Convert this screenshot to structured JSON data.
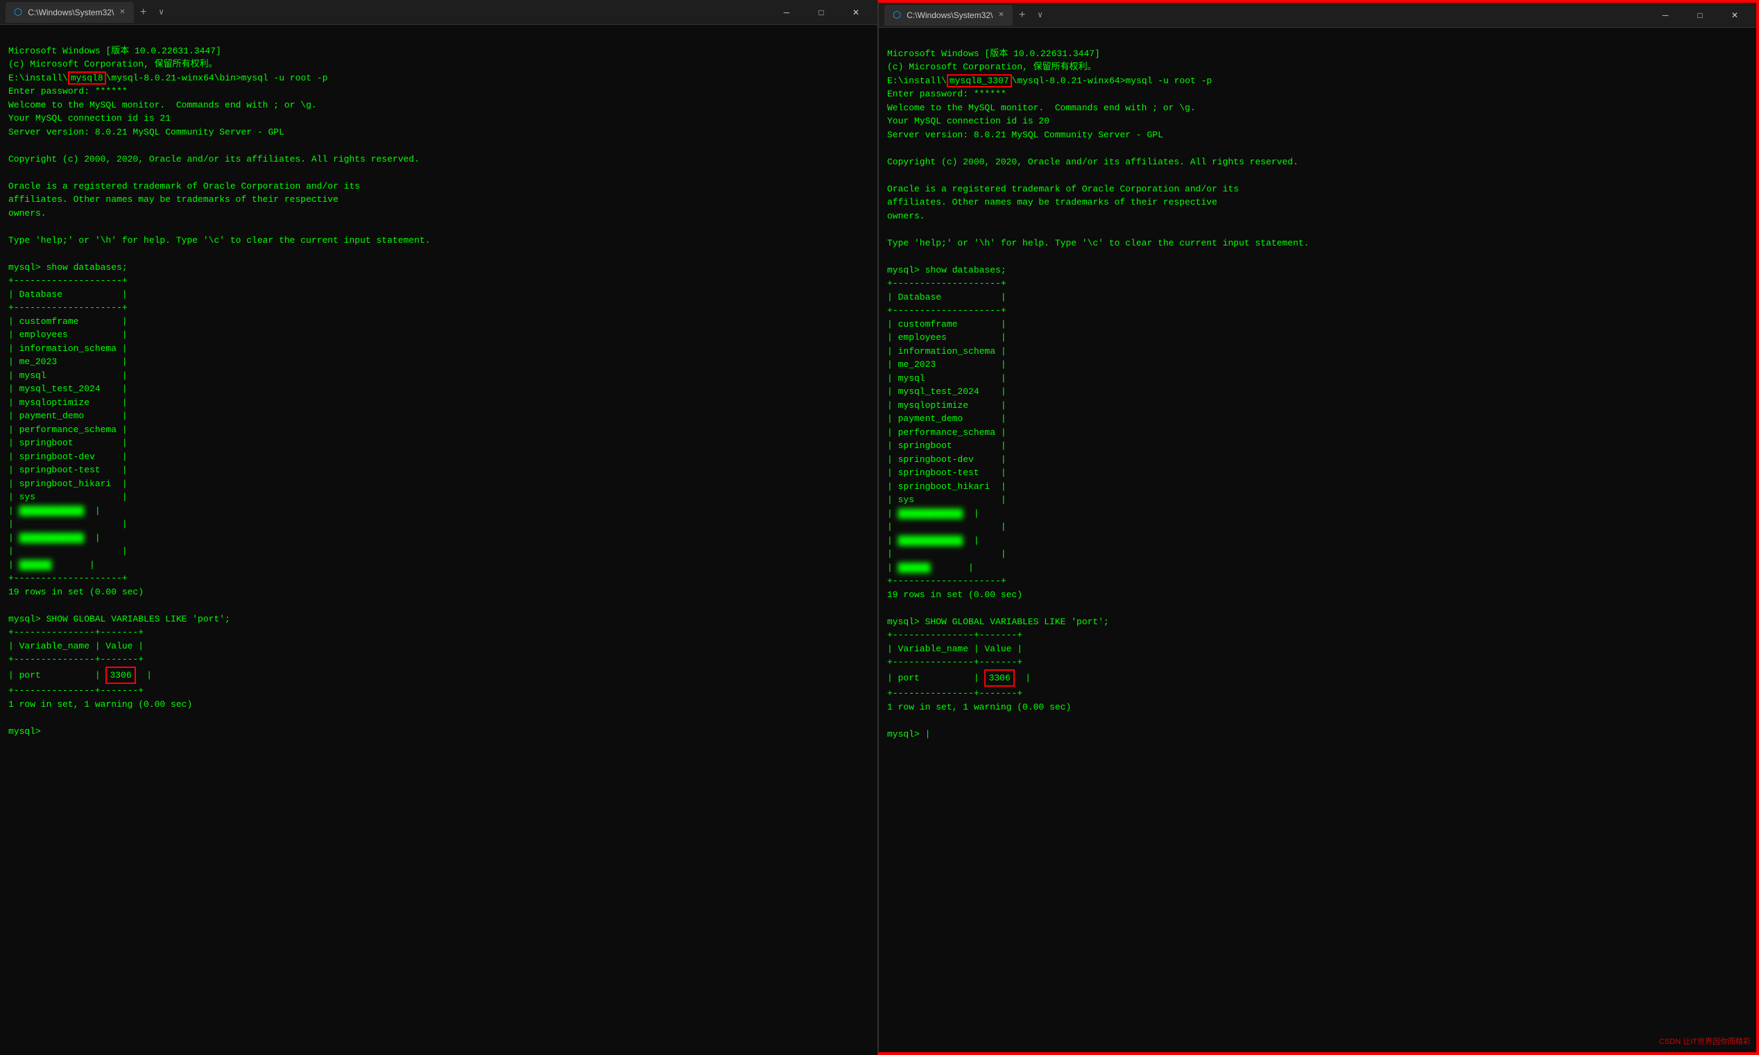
{
  "windows": [
    {
      "id": "left",
      "title": "C:\\Windows\\System32\\",
      "tab_label": "C:\\Windows\\System32\\",
      "content": {
        "line1": "Microsoft Windows [版本 10.0.22631.3447]",
        "line2": "(c) Microsoft Corporation, 保留所有权利。",
        "line3_pre": "E:\\install\\",
        "line3_hl": "mysql8",
        "line3_post": "\\mysql-8.0.21-winx64\\bin>mysql -u root -p",
        "line4": "Enter password: ******",
        "line5": "Welcome to the MySQL monitor.  Commands end with ; or \\g.",
        "line6": "Your MySQL connection id is 21",
        "line7": "Server version: 8.0.21 MySQL Community Server - GPL",
        "line8": "",
        "line9": "Copyright (c) 2000, 2020, Oracle and/or its affiliates. All rights reserved.",
        "line10": "",
        "line11": "Oracle is a registered trademark of Oracle Corporation and/or its",
        "line12": "affiliates. Other names may be trademarks of their respective",
        "line13": "owners.",
        "line14": "",
        "line15": "Type 'help;' or '\\h' for help. Type '\\c' to clear the current input statement.",
        "line16": "",
        "line17": "mysql> show databases;",
        "line18": "+--------------------+",
        "line19": "| Database           |",
        "line20": "+--------------------+",
        "db_list": [
          "customframe",
          "employees",
          "information_schema",
          "me_2023",
          "mysql",
          "mysql_test_2024",
          "mysqloptimize",
          "payment_demo",
          "performance_schema",
          "springboot",
          "springboot-dev",
          "springboot-test",
          "springboot_hikari",
          "sys"
        ],
        "rows_info": "19 rows in set (0.00 sec)",
        "show_vars": "mysql> SHOW GLOBAL VARIABLES LIKE 'port';",
        "var_table_top": "+---------------+-------+",
        "var_table_hdr": "| Variable_name | Value |",
        "var_table_sep": "+---------------+-------+",
        "port_label": "| port",
        "port_value": "3306",
        "var_table_bot": "+---------------+-------+",
        "row_warn": "1 row in set, 1 warning (0.00 sec)",
        "prompt_end": "mysql>"
      }
    },
    {
      "id": "right",
      "title": "C:\\Windows\\System32\\",
      "tab_label": "C:\\Windows\\System32\\",
      "content": {
        "line1": "Microsoft Windows [版本 10.0.22631.3447]",
        "line2": "(c) Microsoft Corporation, 保留所有权利。",
        "line3_pre": "E:\\install\\",
        "line3_hl": "mysql8_3307",
        "line3_post": "\\mysql-8.0.21-winx64>mysql -u root -p",
        "line4": "Enter password: ******",
        "line5": "Welcome to the MySQL monitor.  Commands end with ; or \\g.",
        "line6": "Your MySQL connection id is 20",
        "line7": "Server version: 8.0.21 MySQL Community Server - GPL",
        "line8": "",
        "line9": "Copyright (c) 2000, 2020, Oracle and/or its affiliates. All rights reserved.",
        "line10": "",
        "line11": "Oracle is a registered trademark of Oracle Corporation and/or its",
        "line12": "affiliates. Other names may be trademarks of their respective",
        "line13": "owners.",
        "line14": "",
        "line15": "Type 'help;' or '\\h' for help. Type '\\c' to clear the current input statement.",
        "line16": "",
        "line17": "mysql> show databases;",
        "line18": "+--------------------+",
        "line19": "| Database           |",
        "line20": "+--------------------+",
        "db_list": [
          "customframe",
          "employees",
          "information_schema",
          "me_2023",
          "mysql",
          "mysql_test_2024",
          "mysqloptimize",
          "payment_demo",
          "performance_schema",
          "springboot",
          "springboot-dev",
          "springboot-test",
          "springboot_hikari",
          "sys"
        ],
        "rows_info": "19 rows in set (0.00 sec)",
        "show_vars": "mysql> SHOW GLOBAL VARIABLES LIKE 'port';",
        "var_table_top": "+---------------+-------+",
        "var_table_hdr": "| Variable_name | Value |",
        "var_table_sep": "+---------------+-------+",
        "port_label": "| port",
        "port_value": "3306",
        "var_table_bot": "+---------------+-------+",
        "row_warn": "1 row in set, 1 warning (0.00 sec)",
        "prompt_end": "mysql> |"
      }
    }
  ],
  "controls": {
    "minimize": "─",
    "maximize": "□",
    "close": "✕",
    "add_tab": "+",
    "chevron": "∨"
  },
  "watermark": "CSDN 让IT世界因你而精彩"
}
